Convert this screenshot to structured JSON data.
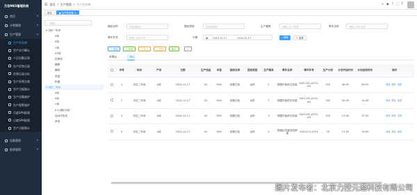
{
  "sidebar": {
    "logo": "万位MES管理系统",
    "items": [
      {
        "label": "首页",
        "icon": "home-icon",
        "type": "top"
      },
      {
        "label": "计划管理",
        "icon": "plan-icon",
        "type": "top"
      },
      {
        "label": "生产管理",
        "icon": "production-icon",
        "type": "top-open"
      },
      {
        "label": "生产任务单",
        "icon": "doc-icon",
        "type": "sub-active"
      },
      {
        "label": "生产交付确认",
        "icon": "doc-icon",
        "type": "sub"
      },
      {
        "label": "人员出勤记录",
        "icon": "doc-icon",
        "type": "sub"
      },
      {
        "label": "生产异常记录",
        "icon": "doc-icon",
        "type": "sub"
      },
      {
        "label": "异常记录分析",
        "icon": "doc-icon",
        "type": "sub"
      },
      {
        "label": "生产异常分类",
        "icon": "doc-icon",
        "type": "sub"
      },
      {
        "label": "生产月报统计",
        "icon": "doc-icon",
        "type": "sub"
      },
      {
        "label": "生产设备维护",
        "icon": "doc-icon",
        "type": "sub"
      },
      {
        "label": "生产报警维护",
        "icon": "doc-icon",
        "type": "sub"
      },
      {
        "label": "月度SPH报表",
        "icon": "doc-icon",
        "type": "sub"
      },
      {
        "label": "日度SPH报表",
        "icon": "doc-icon",
        "type": "sub"
      },
      {
        "label": "生产日报统计",
        "icon": "doc-icon",
        "type": "sub"
      },
      {
        "label": "设备管理",
        "icon": "device-icon",
        "type": "top"
      },
      {
        "label": "报表管理",
        "icon": "report-icon",
        "type": "top"
      }
    ]
  },
  "topbar": {
    "crumbs": [
      "首页",
      "生产管理",
      "生产任务单"
    ]
  },
  "tags": [
    "首页",
    "生产任务单"
  ],
  "tree": {
    "search_placeholder": "请输入",
    "nodes": [
      {
        "label": "冲压一车间",
        "level": 0,
        "selected": false
      },
      {
        "label": "A线",
        "level": 1,
        "selected": false
      },
      {
        "label": "B线",
        "level": 1,
        "selected": false
      },
      {
        "label": "C线",
        "level": 1,
        "selected": false
      },
      {
        "label": "A5线",
        "level": 1,
        "selected": false
      },
      {
        "label": "拉伸线",
        "level": 1,
        "selected": false
      },
      {
        "label": "横移",
        "level": 1,
        "selected": false
      },
      {
        "label": "翻转",
        "level": 1,
        "selected": false
      },
      {
        "label": "质量",
        "level": 1,
        "selected": false
      },
      {
        "label": "机器",
        "level": 1,
        "selected": false
      },
      {
        "label": "冲压二车间",
        "level": 0,
        "selected": true
      },
      {
        "label": "A线",
        "level": 1,
        "selected": false
      },
      {
        "label": "B线",
        "level": 1,
        "selected": false
      },
      {
        "label": "C线",
        "level": 1,
        "selected": false
      },
      {
        "label": "A-14模2冲线",
        "level": 1,
        "selected": false
      },
      {
        "label": "自动冲压线",
        "level": 1,
        "selected": false
      },
      {
        "label": "其他",
        "level": 1,
        "selected": false
      }
    ]
  },
  "form": {
    "row1": [
      {
        "label": "图纸名称",
        "placeholder": "请选择图纸"
      },
      {
        "label": "图纸类型",
        "placeholder": "请选择图纸"
      },
      {
        "label": "生产模具",
        "placeholder": "请输入生产模具"
      },
      {
        "label": "零件名称",
        "placeholder": "请输入零件名称"
      }
    ],
    "row2_label": "零件件号",
    "row2_placeholder": "请输入零件件号",
    "date_label": "日期",
    "date_start": "2024-12-17",
    "date_sep": "-",
    "date_end": "2024-12-17",
    "search_btn": "搜索",
    "reset_btn": "重置"
  },
  "toolbar": [
    {
      "label": "+ 新增",
      "color": "#409eff"
    },
    {
      "label": "✎ 修改",
      "color": "#67c23a"
    },
    {
      "label": "↑ 导入",
      "color": "#e6a23c"
    },
    {
      "label": "↓ 导出",
      "color": "#e6a23c"
    },
    {
      "label": "确认",
      "color": "#67c23a"
    },
    {
      "label": "✕",
      "color": "#999999"
    }
  ],
  "subtabs": [
    "未确认",
    "已确认"
  ],
  "table": {
    "headers": [
      "",
      "序号",
      "车间",
      "产线",
      "日期",
      "生产班组",
      "车型",
      "图纸名称",
      "图纸类型",
      "生产模具",
      "零件名称",
      "零件件号",
      "生产计划",
      "计划开始时间",
      "计划结束时间",
      "操作"
    ],
    "rows": [
      [
        "1",
        "冲压二车间",
        "A线",
        "2024-12-17",
        "A2",
        "M4V",
        "冠冕白色",
        "台阶",
        "1",
        "侧围外板前左安装",
        "5401151-A701-AA",
        "300",
        "08:00",
        "08:55"
      ],
      [
        "2",
        "冲压二车间",
        "A线",
        "2024-12-17",
        "A2",
        "M4V",
        "冠冕白色",
        "台阶",
        "2",
        "侧围外板前右安装",
        "5401152-A701-AA",
        "300",
        "09:00",
        "14:30"
      ],
      [
        "3",
        "冲压二车间",
        "A线",
        "2024-12-17",
        "A2",
        "M4V",
        "冠冕白色",
        "台阶",
        "3",
        "侧围外板前左安装",
        "5401252-A701-AA",
        "200",
        "15:00",
        "17:25"
      ],
      [
        "4",
        "冲压二车间",
        "A线",
        "2024-12-17",
        "A2",
        "M4V",
        "冠冕白色",
        "台阶",
        "4",
        "侧围后内翼总成焊接",
        "5401271-A701",
        "20",
        "17:55",
        "18:00"
      ]
    ],
    "ops": [
      "修改",
      "删除",
      "查看"
    ]
  },
  "watermark": "图片发布者：北京力控元通科技有限公司"
}
